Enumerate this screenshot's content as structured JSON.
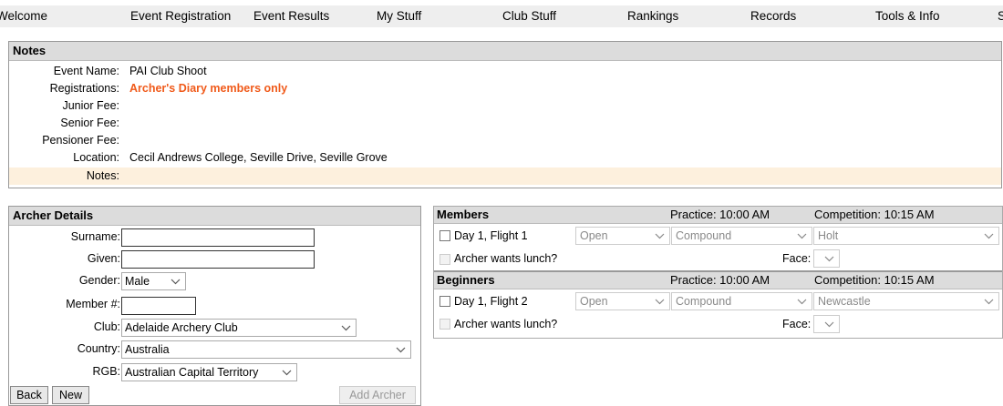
{
  "nav": [
    "Welcome",
    "Event Registration",
    "Event Results",
    "My Stuff",
    "Club Stuff",
    "Rankings",
    "Records",
    "Tools & Info",
    "S"
  ],
  "notes": {
    "title": "Notes",
    "rows": [
      {
        "label": "Event Name:",
        "value": "PAI Club Shoot"
      },
      {
        "label": "Registrations:",
        "value": "Archer's Diary members only"
      },
      {
        "label": "Junior Fee:",
        "value": ""
      },
      {
        "label": "Senior Fee:",
        "value": ""
      },
      {
        "label": "Pensioner Fee:",
        "value": ""
      },
      {
        "label": "Location:",
        "value": "Cecil Andrews College, Seville Drive, Seville Grove"
      },
      {
        "label": "Notes:",
        "value": ""
      }
    ]
  },
  "archer": {
    "title": "Archer Details",
    "surname_label": "Surname:",
    "given_label": "Given:",
    "gender_label": "Gender:",
    "gender_value": "Male",
    "member_label": "Member #:",
    "club_label": "Club:",
    "club_value": "Adelaide Archery Club",
    "country_label": "Country:",
    "country_value": "Australia",
    "rgb_label": "RGB:",
    "rgb_value": "Australian Capital Territory",
    "back": "Back",
    "new": "New",
    "add": "Add Archer"
  },
  "groups": [
    {
      "name": "Members",
      "practice": "Practice: 10:00 AM",
      "competition": "Competition: 10:15 AM",
      "flight": "Day 1, Flight 1",
      "division": "Open",
      "bow": "Compound",
      "venue": "Holt",
      "lunch": "Archer wants lunch?",
      "face_label": "Face:"
    },
    {
      "name": "Beginners",
      "practice": "Practice: 10:00 AM",
      "competition": "Competition: 10:15 AM",
      "flight": "Day 1, Flight 2",
      "division": "Open",
      "bow": "Compound",
      "venue": "Newcastle",
      "lunch": "Archer wants lunch?",
      "face_label": "Face:"
    }
  ]
}
